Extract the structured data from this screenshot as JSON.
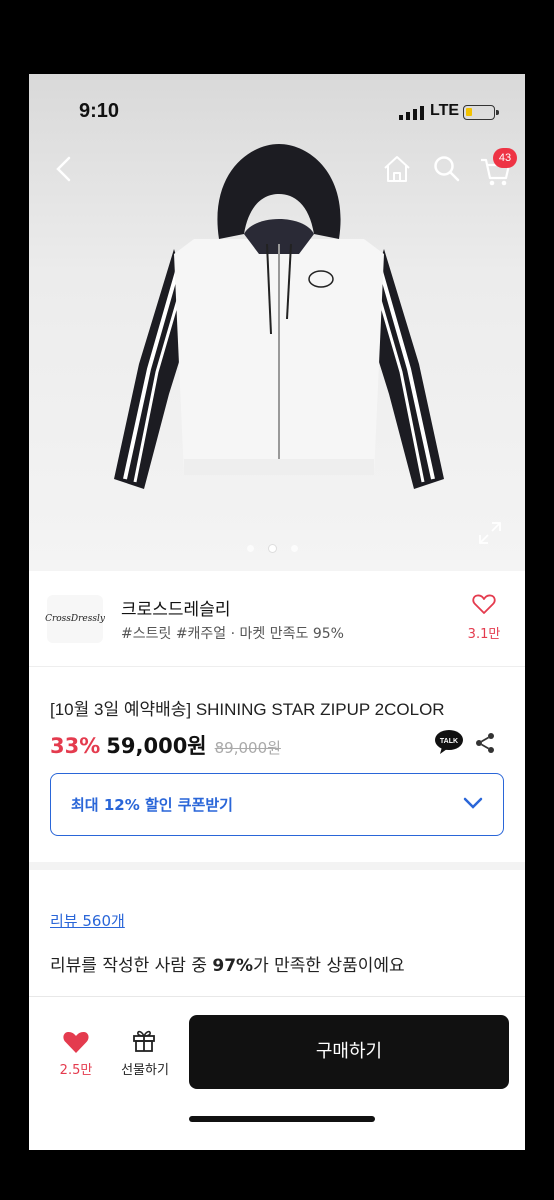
{
  "status_bar": {
    "time": "9:10",
    "network": "LTE"
  },
  "header": {
    "cart_count": "43"
  },
  "seller": {
    "logo_text": "CrossDressly",
    "name": "크로스드레슬리",
    "tags": "#스트릿 #캐주얼 · 마켓 만족도 95%",
    "likes": "3.1만"
  },
  "product": {
    "title": "[10월 3일 예약배송] SHINING STAR ZIPUP 2COLOR",
    "discount": "33%",
    "price": "59,000원",
    "original_price": "89,000원",
    "talk_label": "TALK"
  },
  "coupon": {
    "label": "최대 12% 할인 쿠폰받기"
  },
  "review": {
    "link": "리뷰 560개",
    "text_prefix": "리뷰를 작성한 사람 중 ",
    "text_highlight": "97%",
    "text_suffix": "가 만족한 상품이에요"
  },
  "bottom_bar": {
    "likes": "2.5만",
    "gift_label": "선물하기",
    "buy_label": "구매하기"
  },
  "colors": {
    "accent_red": "#e43b4e",
    "accent_blue": "#2a66d8"
  }
}
